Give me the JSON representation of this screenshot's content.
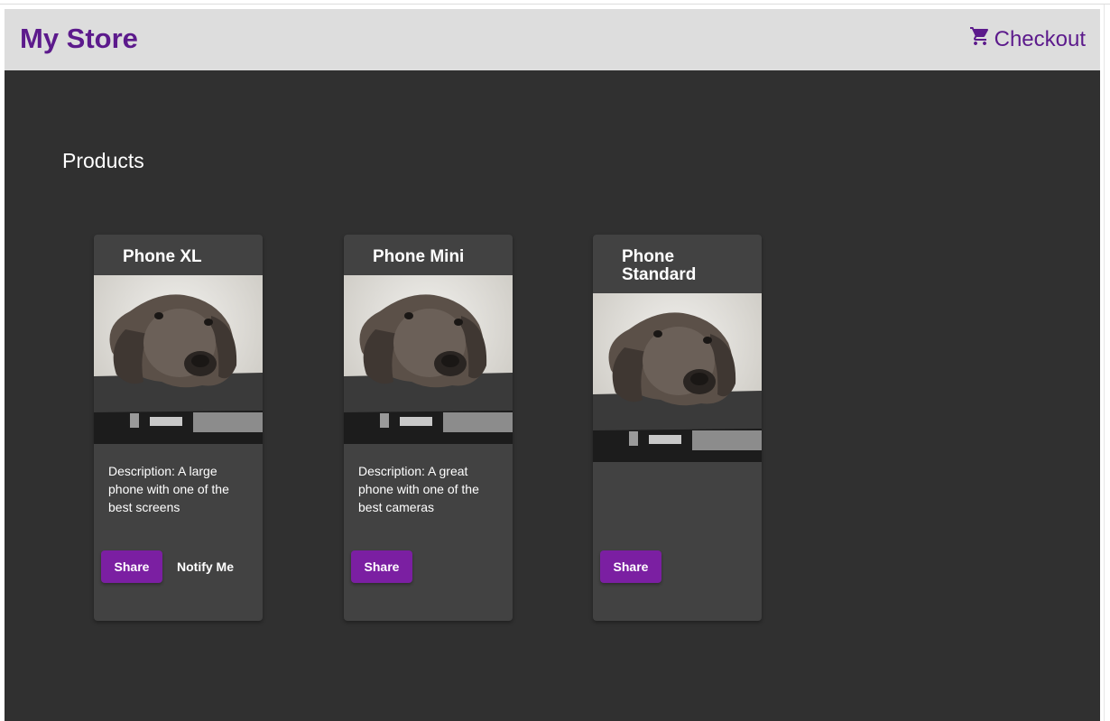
{
  "app": {
    "brand": "My Store",
    "checkout_label": "Checkout"
  },
  "products_title": "Products",
  "products": [
    {
      "name": "Phone XL",
      "description": "Description: A large phone with one of the best screens",
      "share_label": "Share",
      "notify_label": "Notify Me"
    },
    {
      "name": "Phone Mini",
      "description": "Description: A great phone with one of the best cameras",
      "share_label": "Share"
    },
    {
      "name": "Phone Standard",
      "share_label": "Share"
    }
  ],
  "colors": {
    "brand": "#5c1a8c",
    "accent": "#7b1fa2",
    "background": "#303030",
    "card": "#424242",
    "toolbar": "#dddddd"
  },
  "icons": {
    "checkout": "shopping-cart-icon",
    "product_image": "dog-photo"
  }
}
